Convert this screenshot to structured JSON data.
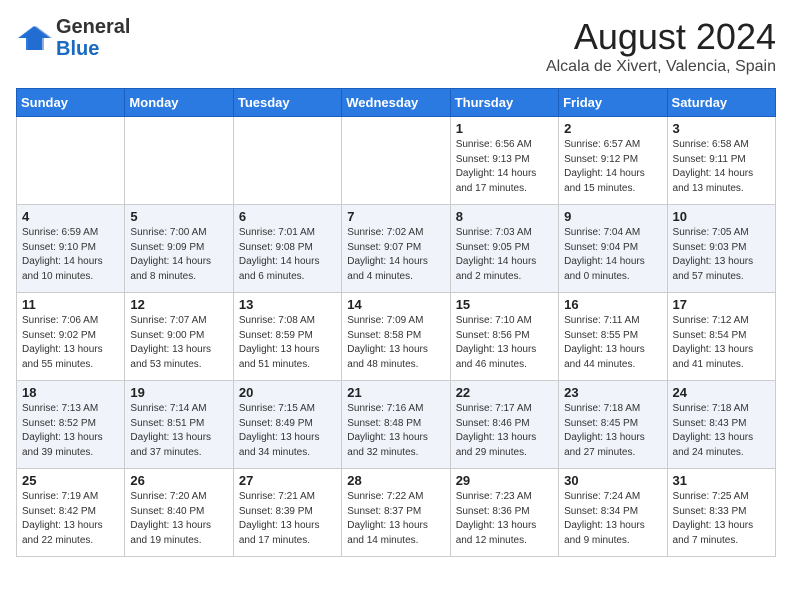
{
  "header": {
    "logo_general": "General",
    "logo_blue": "Blue",
    "month_year": "August 2024",
    "location": "Alcala de Xivert, Valencia, Spain"
  },
  "days_of_week": [
    "Sunday",
    "Monday",
    "Tuesday",
    "Wednesday",
    "Thursday",
    "Friday",
    "Saturday"
  ],
  "weeks": [
    [
      {
        "day": "",
        "text": ""
      },
      {
        "day": "",
        "text": ""
      },
      {
        "day": "",
        "text": ""
      },
      {
        "day": "",
        "text": ""
      },
      {
        "day": "1",
        "text": "Sunrise: 6:56 AM\nSunset: 9:13 PM\nDaylight: 14 hours\nand 17 minutes."
      },
      {
        "day": "2",
        "text": "Sunrise: 6:57 AM\nSunset: 9:12 PM\nDaylight: 14 hours\nand 15 minutes."
      },
      {
        "day": "3",
        "text": "Sunrise: 6:58 AM\nSunset: 9:11 PM\nDaylight: 14 hours\nand 13 minutes."
      }
    ],
    [
      {
        "day": "4",
        "text": "Sunrise: 6:59 AM\nSunset: 9:10 PM\nDaylight: 14 hours\nand 10 minutes."
      },
      {
        "day": "5",
        "text": "Sunrise: 7:00 AM\nSunset: 9:09 PM\nDaylight: 14 hours\nand 8 minutes."
      },
      {
        "day": "6",
        "text": "Sunrise: 7:01 AM\nSunset: 9:08 PM\nDaylight: 14 hours\nand 6 minutes."
      },
      {
        "day": "7",
        "text": "Sunrise: 7:02 AM\nSunset: 9:07 PM\nDaylight: 14 hours\nand 4 minutes."
      },
      {
        "day": "8",
        "text": "Sunrise: 7:03 AM\nSunset: 9:05 PM\nDaylight: 14 hours\nand 2 minutes."
      },
      {
        "day": "9",
        "text": "Sunrise: 7:04 AM\nSunset: 9:04 PM\nDaylight: 14 hours\nand 0 minutes."
      },
      {
        "day": "10",
        "text": "Sunrise: 7:05 AM\nSunset: 9:03 PM\nDaylight: 13 hours\nand 57 minutes."
      }
    ],
    [
      {
        "day": "11",
        "text": "Sunrise: 7:06 AM\nSunset: 9:02 PM\nDaylight: 13 hours\nand 55 minutes."
      },
      {
        "day": "12",
        "text": "Sunrise: 7:07 AM\nSunset: 9:00 PM\nDaylight: 13 hours\nand 53 minutes."
      },
      {
        "day": "13",
        "text": "Sunrise: 7:08 AM\nSunset: 8:59 PM\nDaylight: 13 hours\nand 51 minutes."
      },
      {
        "day": "14",
        "text": "Sunrise: 7:09 AM\nSunset: 8:58 PM\nDaylight: 13 hours\nand 48 minutes."
      },
      {
        "day": "15",
        "text": "Sunrise: 7:10 AM\nSunset: 8:56 PM\nDaylight: 13 hours\nand 46 minutes."
      },
      {
        "day": "16",
        "text": "Sunrise: 7:11 AM\nSunset: 8:55 PM\nDaylight: 13 hours\nand 44 minutes."
      },
      {
        "day": "17",
        "text": "Sunrise: 7:12 AM\nSunset: 8:54 PM\nDaylight: 13 hours\nand 41 minutes."
      }
    ],
    [
      {
        "day": "18",
        "text": "Sunrise: 7:13 AM\nSunset: 8:52 PM\nDaylight: 13 hours\nand 39 minutes."
      },
      {
        "day": "19",
        "text": "Sunrise: 7:14 AM\nSunset: 8:51 PM\nDaylight: 13 hours\nand 37 minutes."
      },
      {
        "day": "20",
        "text": "Sunrise: 7:15 AM\nSunset: 8:49 PM\nDaylight: 13 hours\nand 34 minutes."
      },
      {
        "day": "21",
        "text": "Sunrise: 7:16 AM\nSunset: 8:48 PM\nDaylight: 13 hours\nand 32 minutes."
      },
      {
        "day": "22",
        "text": "Sunrise: 7:17 AM\nSunset: 8:46 PM\nDaylight: 13 hours\nand 29 minutes."
      },
      {
        "day": "23",
        "text": "Sunrise: 7:18 AM\nSunset: 8:45 PM\nDaylight: 13 hours\nand 27 minutes."
      },
      {
        "day": "24",
        "text": "Sunrise: 7:18 AM\nSunset: 8:43 PM\nDaylight: 13 hours\nand 24 minutes."
      }
    ],
    [
      {
        "day": "25",
        "text": "Sunrise: 7:19 AM\nSunset: 8:42 PM\nDaylight: 13 hours\nand 22 minutes."
      },
      {
        "day": "26",
        "text": "Sunrise: 7:20 AM\nSunset: 8:40 PM\nDaylight: 13 hours\nand 19 minutes."
      },
      {
        "day": "27",
        "text": "Sunrise: 7:21 AM\nSunset: 8:39 PM\nDaylight: 13 hours\nand 17 minutes."
      },
      {
        "day": "28",
        "text": "Sunrise: 7:22 AM\nSunset: 8:37 PM\nDaylight: 13 hours\nand 14 minutes."
      },
      {
        "day": "29",
        "text": "Sunrise: 7:23 AM\nSunset: 8:36 PM\nDaylight: 13 hours\nand 12 minutes."
      },
      {
        "day": "30",
        "text": "Sunrise: 7:24 AM\nSunset: 8:34 PM\nDaylight: 13 hours\nand 9 minutes."
      },
      {
        "day": "31",
        "text": "Sunrise: 7:25 AM\nSunset: 8:33 PM\nDaylight: 13 hours\nand 7 minutes."
      }
    ]
  ]
}
